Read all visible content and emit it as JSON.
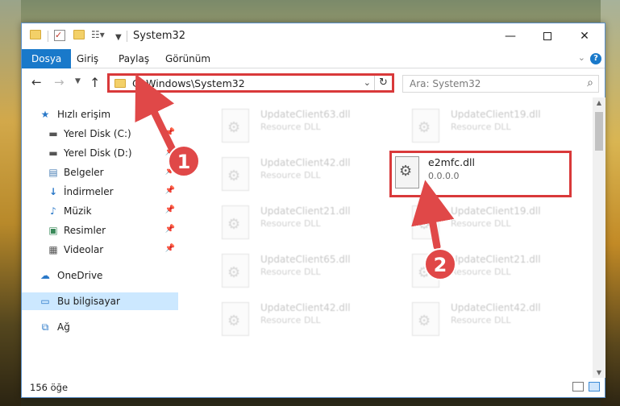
{
  "window": {
    "title": "System32"
  },
  "ribbon": {
    "tabs": [
      "Dosya",
      "Giriş",
      "Paylaş",
      "Görünüm"
    ],
    "help_label": "?"
  },
  "address": {
    "path": "C:\\Windows\\System32",
    "search_placeholder": "Ara: System32"
  },
  "nav_pane": {
    "quick_access": "Hızlı erişim",
    "items": [
      {
        "label": "Yerel Disk (C:)",
        "pinned": true
      },
      {
        "label": "Yerel Disk (D:)",
        "pinned": true
      },
      {
        "label": "Belgeler",
        "pinned": true
      },
      {
        "label": "İndirmeler",
        "pinned": true
      },
      {
        "label": "Müzik",
        "pinned": true
      },
      {
        "label": "Resimler",
        "pinned": true
      },
      {
        "label": "Videolar",
        "pinned": true
      }
    ],
    "onedrive": "OneDrive",
    "this_pc": "Bu bilgisayar",
    "network": "Ağ"
  },
  "files": {
    "blurred": [
      {
        "name": "UpdateClient63.dll",
        "desc": "Resource DLL"
      },
      {
        "name": "UpdateClient19.dll",
        "desc": "Resource DLL"
      },
      {
        "name": "UpdateClient42.dll",
        "desc": "Resource DLL"
      },
      {
        "name": "UpdateClient21.dll",
        "desc": "Resource DLL"
      },
      {
        "name": "UpdateClient19.dll",
        "desc": "Resource DLL"
      },
      {
        "name": "UpdateClient65.dll",
        "desc": "Resource DLL"
      },
      {
        "name": "UpdateClient21.dll",
        "desc": "Resource DLL"
      },
      {
        "name": "UpdateClient42.dll",
        "desc": "Resource DLL"
      },
      {
        "name": "UpdateClient42.dll",
        "desc": "Resource DLL"
      }
    ],
    "highlighted": {
      "name": "e2mfc.dll",
      "version": "0.0.0.0",
      "extra": "-"
    }
  },
  "status": {
    "count": "156 öğe"
  },
  "annotations": {
    "step1": "1",
    "step2": "2",
    "color": "#e04848"
  }
}
